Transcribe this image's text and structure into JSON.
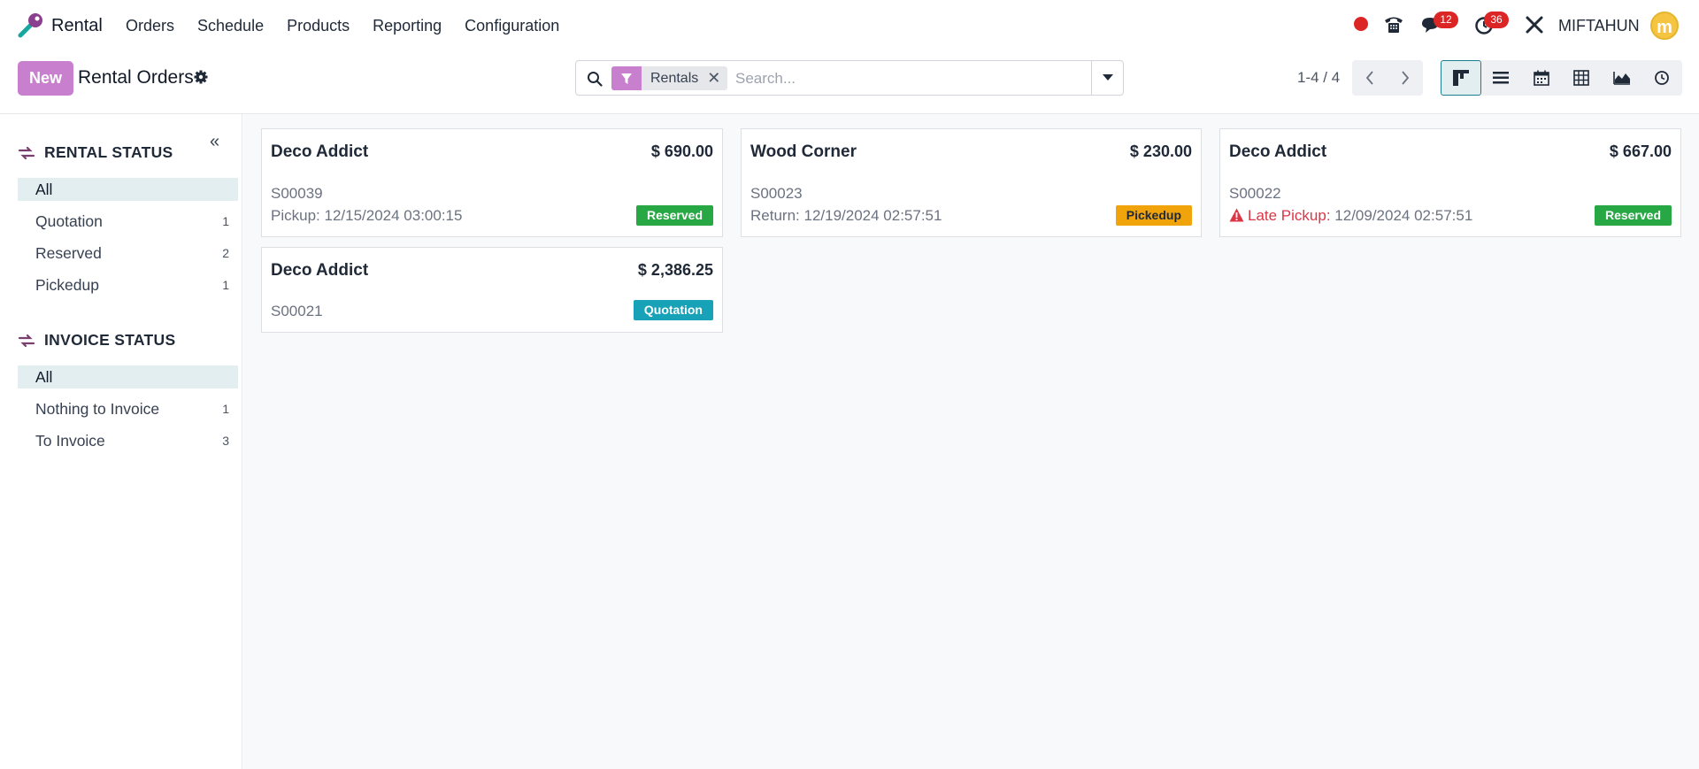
{
  "navbar": {
    "app_name": "Rental",
    "menu": [
      "Orders",
      "Schedule",
      "Products",
      "Reporting",
      "Configuration"
    ],
    "messages_count": "12",
    "activities_count": "36",
    "username": "MIFTAHUN",
    "avatar_initial": "m",
    "icons": [
      "app-logo-icon",
      "recording-dot-icon",
      "phone-icon",
      "chat-icon",
      "clock-icon",
      "tools-icon"
    ]
  },
  "control_panel": {
    "new_label": "New",
    "title": "Rental Orders",
    "search": {
      "facet_label": "Rentals",
      "placeholder": "Search..."
    },
    "pager": "1-4 / 4",
    "views": [
      "kanban",
      "list",
      "calendar",
      "pivot",
      "graph",
      "activity"
    ],
    "active_view": "kanban"
  },
  "sidebar": {
    "sections": [
      {
        "title": "RENTAL STATUS",
        "items": [
          {
            "label": "All",
            "count": "",
            "active": true
          },
          {
            "label": "Quotation",
            "count": "1"
          },
          {
            "label": "Reserved",
            "count": "2"
          },
          {
            "label": "Pickedup",
            "count": "1"
          }
        ]
      },
      {
        "title": "INVOICE STATUS",
        "items": [
          {
            "label": "All",
            "count": "",
            "active": true
          },
          {
            "label": "Nothing to Invoice",
            "count": "1"
          },
          {
            "label": "To Invoice",
            "count": "3"
          }
        ]
      }
    ]
  },
  "cards": [
    {
      "customer": "Deco Addict",
      "amount": "$ 690.00",
      "ref": "S00039",
      "date_label": "Pickup:",
      "date": "12/15/2024 03:00:15",
      "status": "Reserved",
      "late": false
    },
    {
      "customer": "Wood Corner",
      "amount": "$ 230.00",
      "ref": "S00023",
      "date_label": "Return:",
      "date": "12/19/2024 02:57:51",
      "status": "Pickedup",
      "late": false
    },
    {
      "customer": "Deco Addict",
      "amount": "$ 667.00",
      "ref": "S00022",
      "date_label": "Late Pickup:",
      "date": "12/09/2024 02:57:51",
      "status": "Reserved",
      "late": true
    },
    {
      "customer": "Deco Addict",
      "amount": "$ 2,386.25",
      "ref": "S00021",
      "date_label": "",
      "date": "",
      "status": "Quotation",
      "late": false
    }
  ],
  "colors": {
    "accent": "#c77fce",
    "reserved": "#28a745",
    "pickedup": "#f0a30a",
    "quotation": "#17a2b8",
    "late": "#dc3545",
    "badge": "#dc2626"
  }
}
